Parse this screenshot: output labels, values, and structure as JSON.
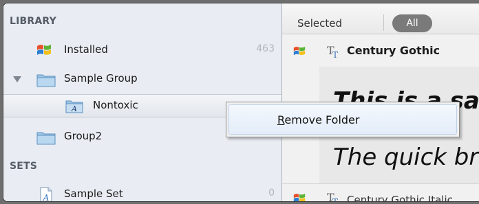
{
  "sidebar": {
    "library_header": "LIBRARY",
    "sets_header": "SETS",
    "items": [
      {
        "label": "Installed",
        "count": "463",
        "icon": "windows-flag-icon"
      },
      {
        "label": "Sample Group",
        "icon": "folder-icon",
        "expanded": true
      },
      {
        "label": "Nontoxic",
        "icon": "font-folder-icon",
        "selected": true
      },
      {
        "label": "Group2",
        "icon": "folder-icon"
      }
    ],
    "sets": [
      {
        "label": "Sample Set",
        "count": "0",
        "icon": "font-file-icon"
      }
    ]
  },
  "toolbar": {
    "selected_label": "Selected",
    "all_label": "All"
  },
  "fonts": [
    {
      "name": "Century Gothic",
      "preview_line1": "This is a sample",
      "preview_line2": "The quick brown fox"
    },
    {
      "name": "Century Gothic Italic"
    }
  ],
  "context_menu": {
    "item_prefix": "",
    "item_mnemonic": "R",
    "item_rest": "emove Folder"
  },
  "colors": {
    "sidebar_bg": "#e9edf3",
    "all_pill": "#7a7a7a",
    "menu_highlight": "#e3ecf8"
  }
}
